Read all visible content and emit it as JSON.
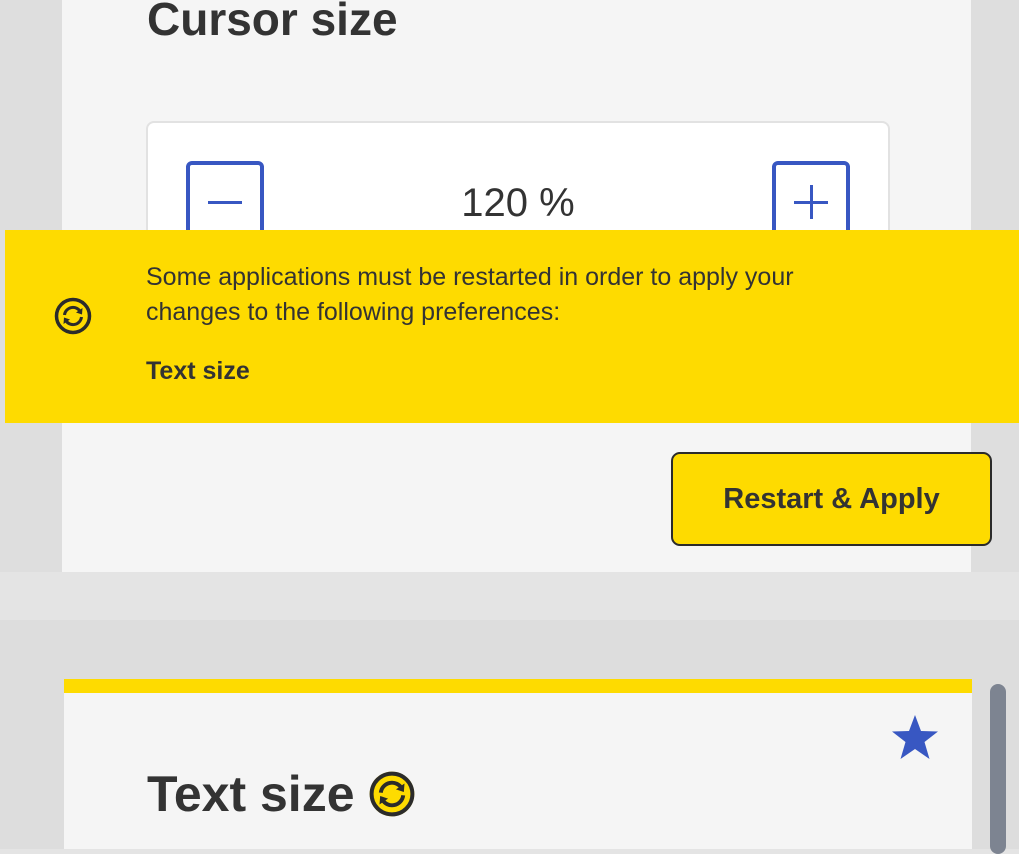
{
  "cursor_section": {
    "title": "Cursor size",
    "stepper": {
      "value": "120 %",
      "decrease_icon": "minus-icon",
      "increase_icon": "plus-icon"
    }
  },
  "restart_notice": {
    "icon": "refresh-icon",
    "message": "Some applications must be restarted in order to apply your changes to the following preferences:",
    "preferences": [
      "Text size"
    ],
    "button_label": "Restart & Apply"
  },
  "text_size_section": {
    "title": "Text size",
    "title_icon": "refresh-icon",
    "favorite_icon": "star-icon"
  },
  "colors": {
    "accent_yellow": "#fedb00",
    "accent_blue": "#3857c2",
    "text": "#333333",
    "panel_bg": "#dedede",
    "card_bg": "#f5f5f5"
  }
}
